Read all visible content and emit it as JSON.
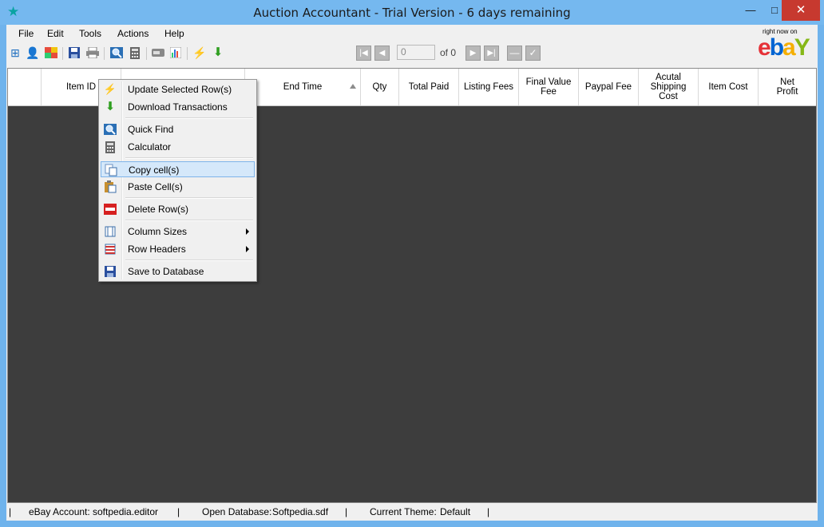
{
  "window": {
    "title": "Auction Accountant - Trial Version - 6 days remaining",
    "minimize": "—",
    "maximize": "□",
    "close": "✕",
    "app_icon": "★"
  },
  "menu": [
    "File",
    "Edit",
    "Tools",
    "Actions",
    "Help"
  ],
  "toolbar": {
    "icons": [
      "add-record-icon",
      "add-user-icon",
      "theme-icon",
      "save-icon",
      "print-icon",
      "quick-find-icon",
      "calculator-icon",
      "card-icon",
      "chart-icon",
      "update-icon",
      "download-icon"
    ],
    "page_value": "0",
    "page_of": "of 0"
  },
  "ebay": {
    "tagline": "right now on",
    "e": "e",
    "b": "b",
    "a": "a",
    "y": "Y"
  },
  "grid": {
    "columns": [
      "Item ID",
      "",
      "End Time",
      "Qty",
      "Total Paid",
      "Listing Fees",
      "Final Value Fee",
      "Paypal Fee",
      "Acutal Shipping Cost",
      "Item Cost",
      "Net Profit"
    ],
    "sort_column": "End Time"
  },
  "context_menu": {
    "items": [
      {
        "label": "Update Selected Row(s)",
        "icon": "lightning-icon",
        "glyph": "⚡",
        "color": "#e87a1a"
      },
      {
        "label": "Download Transactions",
        "icon": "download-arrow-icon",
        "glyph": "⬇",
        "color": "#2e9e1f"
      },
      {
        "label": "Quick Find",
        "icon": "quick-find-icon",
        "glyph": "🔍",
        "color": "#2a6fb5"
      },
      {
        "label": "Calculator",
        "icon": "calculator-icon",
        "glyph": "▦",
        "color": "#555555"
      },
      {
        "label": "Copy cell(s)",
        "icon": "copy-icon",
        "glyph": "❐",
        "color": "#3b6ea8"
      },
      {
        "label": "Paste Cell(s)",
        "icon": "paste-icon",
        "glyph": "📋",
        "color": "#b07a1e"
      },
      {
        "label": "Delete Row(s)",
        "icon": "delete-row-icon",
        "glyph": "▬",
        "color": "#d62020"
      },
      {
        "label": "Column Sizes",
        "icon": "column-sizes-icon",
        "glyph": "⇹",
        "color": "#3b6ea8"
      },
      {
        "label": "Row Headers",
        "icon": "row-headers-icon",
        "glyph": "☰",
        "color": "#cc3333"
      },
      {
        "label": "Save to Database",
        "icon": "save-icon",
        "glyph": "💾",
        "color": "#2a4f9e"
      }
    ],
    "highlighted": "Copy cell(s)"
  },
  "status": {
    "sep": "|",
    "account_label": "eBay Account:",
    "account_value": "softpedia.editor",
    "db_label": "Open Database:",
    "db_value": "Softpedia.sdf",
    "theme_label": "Current Theme:",
    "theme_value": "Default"
  }
}
